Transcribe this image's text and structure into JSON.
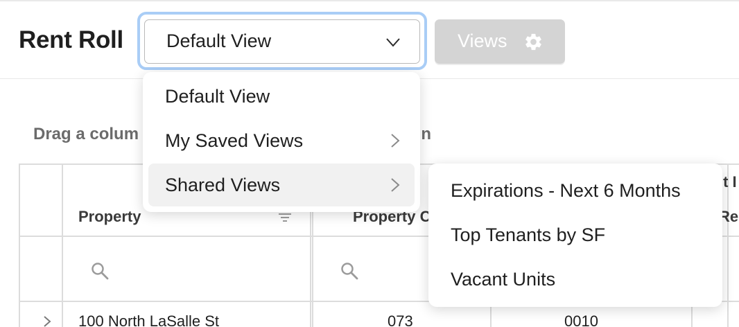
{
  "header": {
    "title": "Rent Roll",
    "view_select": {
      "value": "Default View"
    },
    "views_button": {
      "label": "Views"
    }
  },
  "group_panel": {
    "hint_start": "Drag a colum",
    "hint_end": "mn"
  },
  "grid": {
    "columns": [
      {
        "header": "Property",
        "icons": [
          "filter-icon",
          "search-icon"
        ]
      },
      {
        "header": "Property C",
        "icons": [
          "search-icon"
        ]
      },
      {
        "header": "",
        "icons": []
      },
      {
        "header": "Re",
        "icons": []
      }
    ],
    "partial_header_above": "it I",
    "rows": [
      {
        "property": "100 North LaSalle St",
        "property_code": "073",
        "unit": "0010"
      }
    ]
  },
  "view_menu": {
    "items": [
      {
        "label": "Default View",
        "has_submenu": false
      },
      {
        "label": "My Saved Views",
        "has_submenu": true
      },
      {
        "label": "Shared Views",
        "has_submenu": true,
        "highlighted": true
      }
    ]
  },
  "shared_views_submenu": {
    "items": [
      {
        "label": "Expirations - Next 6 Months"
      },
      {
        "label": "Top Tenants by SF"
      },
      {
        "label": "Vacant Units"
      }
    ]
  },
  "colors": {
    "focus_ring": "#a9cdf6",
    "disabled_button": "#d4d4d4",
    "hover_bg": "#f1f1f1",
    "text": "#1f1f1f",
    "muted_text": "#6b6b6b",
    "grid_line": "#dcdcdc"
  }
}
